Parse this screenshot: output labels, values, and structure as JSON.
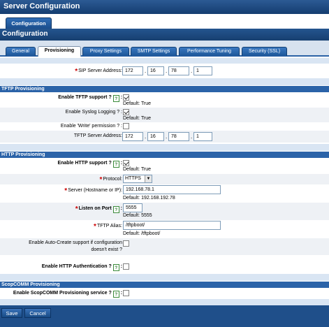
{
  "window_title": "Server Configuration",
  "top_tab": "Configuration",
  "page_title": "Configuration",
  "tabs": [
    "General",
    "Provisioning",
    "Proxy Settings",
    "SMTP Settings",
    "Performance Tuning",
    "Security (SSL)"
  ],
  "sip": {
    "label": "SIP Server Address:",
    "ip": [
      "172",
      "16",
      "78",
      "1"
    ]
  },
  "tftp": {
    "header": "TFTP Provisioning",
    "enable_label": "Enable TFTP support ?",
    "enable_default": "Default: True",
    "syslog_label": "Enable Syslog Logging ?",
    "syslog_default": "Default: True",
    "write_label": "Enable 'Write' permission ?",
    "address_label": "TFTP Server Address:",
    "ip": [
      "172",
      "16",
      "78",
      "1"
    ]
  },
  "http": {
    "header": "HTTP Provisioning",
    "enable_label": "Enable HTTP support ?",
    "enable_default": "Default: True",
    "protocol_label": "Protocol:",
    "protocol_value": "HTTPS",
    "server_label": "Server (Hostname or IP):",
    "server_value": "192.168.78.1",
    "server_default": "Default: 192.168.192.78",
    "port_label": "Listen on Port",
    "port_value": "5555",
    "port_default": "Default: 5555",
    "alias_label": "TFTP Alias:",
    "alias_value": "/tftpboot/",
    "alias_default": "Default: /tftpboot/",
    "autocreate_label_1": "Enable Auto-Create support if configuration",
    "autocreate_label_2": "doesn't exist ?",
    "auth_label": "Enable HTTP Authentication ?"
  },
  "scop": {
    "header": "ScopCOMM Provisioning",
    "enable_label": "Enable ScopCOMM Provisioning service ?"
  },
  "buttons": {
    "save": "Save",
    "cancel": "Cancel"
  },
  "icons": {
    "help": "help-icon",
    "required": "required-star-icon"
  },
  "colors": {
    "header_blue": "#2b63a8",
    "band": "#d9e5f3",
    "required_star": "#cc0000"
  }
}
